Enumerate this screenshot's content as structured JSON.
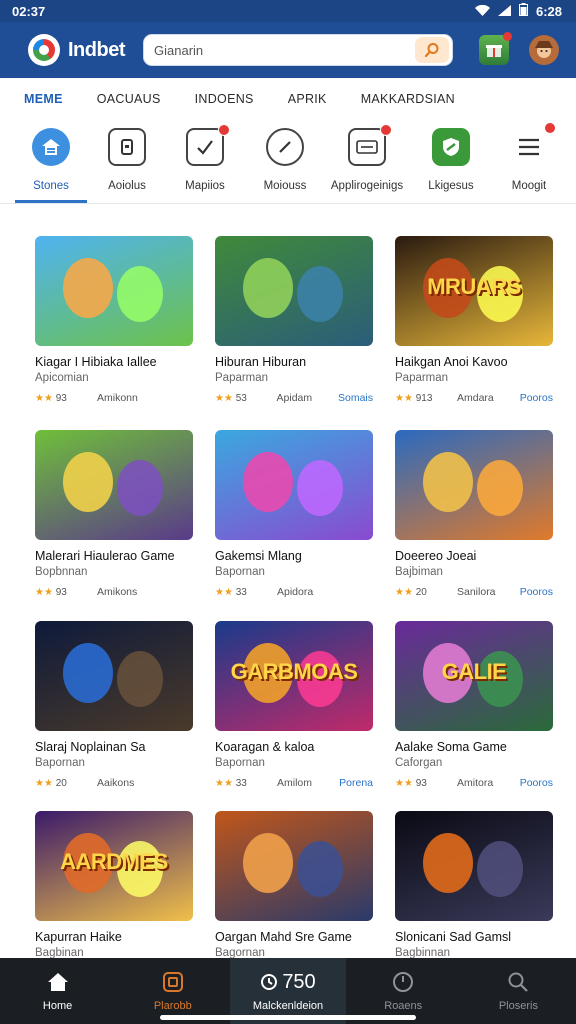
{
  "status": {
    "time_left": "02:37",
    "time_right": "6:28"
  },
  "header": {
    "brand": "Indbet",
    "search_placeholder": "Gianarin"
  },
  "tabs": [
    "MEME",
    "OACUAUS",
    "INDOENS",
    "APRIK",
    "MAKKARDSIAN"
  ],
  "categories": [
    {
      "label": "Stones",
      "icon": "home-icon",
      "active": true
    },
    {
      "label": "Aoiolus",
      "icon": "phone-icon"
    },
    {
      "label": "Mapiios",
      "icon": "check-icon",
      "badge": true
    },
    {
      "label": "Moiouss",
      "icon": "slash-circle-icon"
    },
    {
      "label": "Applirogeinigs",
      "icon": "screen-icon",
      "badge": true
    },
    {
      "label": "Lkigesus",
      "icon": "shield-icon"
    },
    {
      "label": "Moogit",
      "icon": "menu-icon",
      "badge": true
    }
  ],
  "cards": [
    {
      "title": "Kiagar I Hibiaka Iallee",
      "subtitle": "Apicomian",
      "rating": "93",
      "downloads": "Amikonn",
      "link": "",
      "thumb_text": ""
    },
    {
      "title": "Hiburan Hiburan",
      "subtitle": "Paparman",
      "rating": "53",
      "downloads": "Apidam",
      "link": "Somais",
      "thumb_text": ""
    },
    {
      "title": "Haikgan Anoi Kavoo",
      "subtitle": "Paparman",
      "rating": "913",
      "downloads": "Amdara",
      "link": "Pooros",
      "thumb_text": "MRUARS"
    },
    {
      "title": "Malerari Hiaulerao Game",
      "subtitle": "Bopbnnan",
      "rating": "93",
      "downloads": "Amikons",
      "link": "",
      "thumb_text": ""
    },
    {
      "title": "Gakemsi Mlang",
      "subtitle": "Bapornan",
      "rating": "33",
      "downloads": "Apidora",
      "link": "",
      "thumb_text": ""
    },
    {
      "title": "Doeereo Joeai",
      "subtitle": "Bajbiman",
      "rating": "20",
      "downloads": "Sanilora",
      "link": "Pooros",
      "thumb_text": ""
    },
    {
      "title": "Slaraj Noplainan Sa",
      "subtitle": "Bapornan",
      "rating": "20",
      "downloads": "Aaikons",
      "link": "",
      "thumb_text": ""
    },
    {
      "title": "Koaragan & kaloa",
      "subtitle": "Bapornan",
      "rating": "33",
      "downloads": "Amilom",
      "link": "Porena",
      "thumb_text": "GARBMOAS"
    },
    {
      "title": "Aalake Soma Game",
      "subtitle": "Caforgan",
      "rating": "93",
      "downloads": "Amitora",
      "link": "Pooros",
      "thumb_text": "GALIE"
    },
    {
      "title": "Kapurran Haike",
      "subtitle": "Bagbinan",
      "rating": "",
      "downloads": "",
      "link": "",
      "thumb_text": "AARDMES"
    },
    {
      "title": "Oargan Mahd Sre Game",
      "subtitle": "Bagornan",
      "rating": "",
      "downloads": "",
      "link": "",
      "thumb_text": ""
    },
    {
      "title": "Slonicani Sad Gamsl",
      "subtitle": "Bagbinnan",
      "rating": "",
      "downloads": "",
      "link": "",
      "thumb_text": ""
    }
  ],
  "nav": [
    {
      "label": "Home",
      "icon": "home-icon"
    },
    {
      "label": "Plarobb",
      "icon": "square-icon"
    },
    {
      "label": "Malckenldeion",
      "icon": "clock-icon",
      "value": "750"
    },
    {
      "label": "Roaens",
      "icon": "timer-icon"
    },
    {
      "label": "Ploseris",
      "icon": "search-icon"
    }
  ],
  "colors": {
    "header": "#1f4d96",
    "accent": "#1f5fb5",
    "star": "#f0a020",
    "link": "#2a75c8"
  }
}
